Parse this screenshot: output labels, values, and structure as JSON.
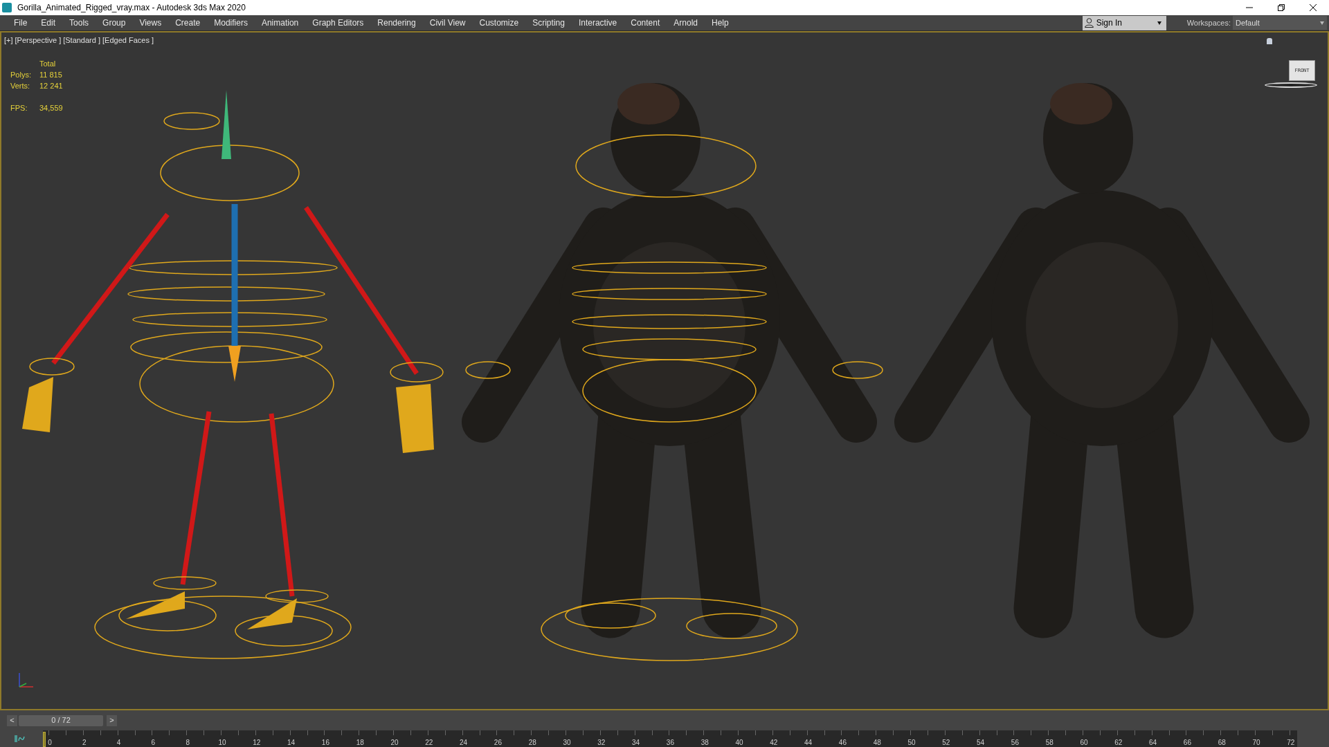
{
  "window": {
    "title": "Gorilla_Animated_Rigged_vray.max - Autodesk 3ds Max 2020"
  },
  "menu": [
    "File",
    "Edit",
    "Tools",
    "Group",
    "Views",
    "Create",
    "Modifiers",
    "Animation",
    "Graph Editors",
    "Rendering",
    "Civil View",
    "Customize",
    "Scripting",
    "Interactive",
    "Content",
    "Arnold",
    "Help"
  ],
  "sign_in": {
    "label": "Sign In"
  },
  "workspaces": {
    "label": "Workspaces:",
    "value": "Default"
  },
  "viewport": {
    "labels": [
      "[+]",
      "[Perspective ]",
      "[Standard ]",
      "[Edged Faces ]"
    ],
    "stats": {
      "header": "Total",
      "rows": [
        {
          "label": "Polys:",
          "value": "11 815"
        },
        {
          "label": "Verts:",
          "value": "12 241"
        }
      ],
      "fps_label": "FPS:",
      "fps_value": "34,559"
    },
    "view_cube": {
      "label": "FRONT"
    }
  },
  "time_slider": {
    "prev": "<",
    "next": ">",
    "value": "0 / 72",
    "level": 0
  },
  "timeline": {
    "ticks": [
      "0",
      "2",
      "4",
      "6",
      "8",
      "10",
      "12",
      "14",
      "16",
      "18",
      "20",
      "22",
      "24",
      "26",
      "28",
      "30",
      "32",
      "34",
      "36",
      "38",
      "40",
      "42",
      "44",
      "46",
      "48",
      "50",
      "52",
      "54",
      "56",
      "58",
      "60",
      "62",
      "64",
      "66",
      "68",
      "70",
      "72"
    ]
  }
}
